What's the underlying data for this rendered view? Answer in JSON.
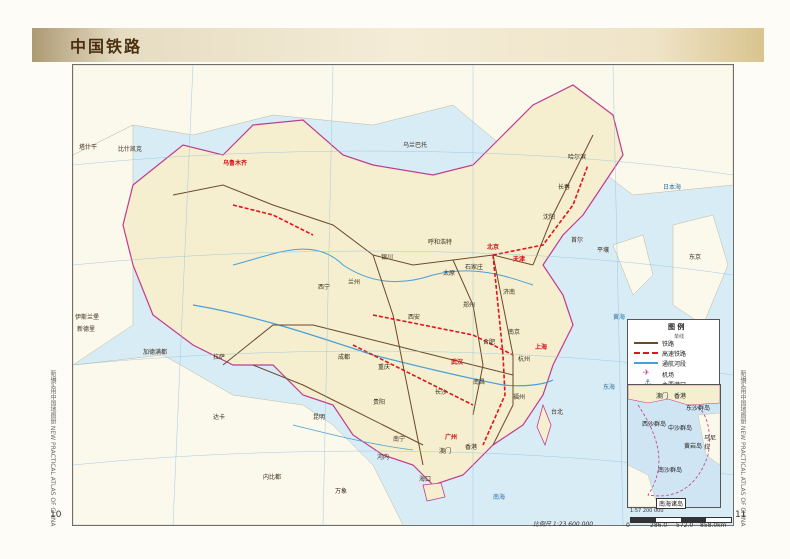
{
  "header": {
    "title": "中国铁路"
  },
  "side_text": {
    "left": "新编实用中国地图册 NEW PRACTICAL ATLAS OF CHINA",
    "right": "新编实用中国地图册 NEW PRACTICAL ATLAS OF CHINA"
  },
  "pages": {
    "left": "10",
    "right": "11"
  },
  "scale": {
    "label": "比例尺 1:23 600 000",
    "ticks": [
      "0",
      "286.0",
      "572.0",
      "858.0km"
    ]
  },
  "legend": {
    "title": "图 例",
    "items": [
      {
        "label": "铁路",
        "sub": "单线"
      },
      {
        "label": "高速铁路",
        "sub": ""
      },
      {
        "label": "通航河段",
        "sub": ""
      },
      {
        "label": "机场",
        "sub": ""
      },
      {
        "label": "主要港口",
        "sub": ""
      }
    ]
  },
  "inset": {
    "title": "南海诸岛",
    "scale": "1:57 200 000",
    "labels": [
      "香港",
      "澳门",
      "东沙群岛",
      "马尼拉",
      "黄岩岛",
      "中沙群岛",
      "西沙群岛",
      "南沙群岛"
    ]
  },
  "map_labels": {
    "countries": [
      "乌兰巴托",
      "比什凯克",
      "塔什干",
      "伊斯兰堡",
      "新德里",
      "加德满都",
      "达卡",
      "内比都",
      "河内",
      "万象",
      "首尔",
      "平壤",
      "东京",
      "乌鲁木齐"
    ],
    "cities": [
      "北京",
      "天津",
      "石家庄",
      "太原",
      "呼和浩特",
      "沈阳",
      "长春",
      "哈尔滨",
      "济南",
      "郑州",
      "西安",
      "兰州",
      "银川",
      "西宁",
      "拉萨",
      "成都",
      "重庆",
      "贵阳",
      "昆明",
      "南宁",
      "广州",
      "长沙",
      "武汉",
      "南昌",
      "合肥",
      "南京",
      "上海",
      "杭州",
      "福州",
      "台北",
      "海口",
      "香港",
      "澳门"
    ],
    "features": [
      "黄海",
      "东海",
      "日本海",
      "南海"
    ]
  },
  "colors": {
    "land": "#f5efcf",
    "sea": "#d8ecf6",
    "rail": "#6b4a2a",
    "highspeed": "#e0141d",
    "river": "#4a9fd8",
    "border": "#c23a8f"
  }
}
